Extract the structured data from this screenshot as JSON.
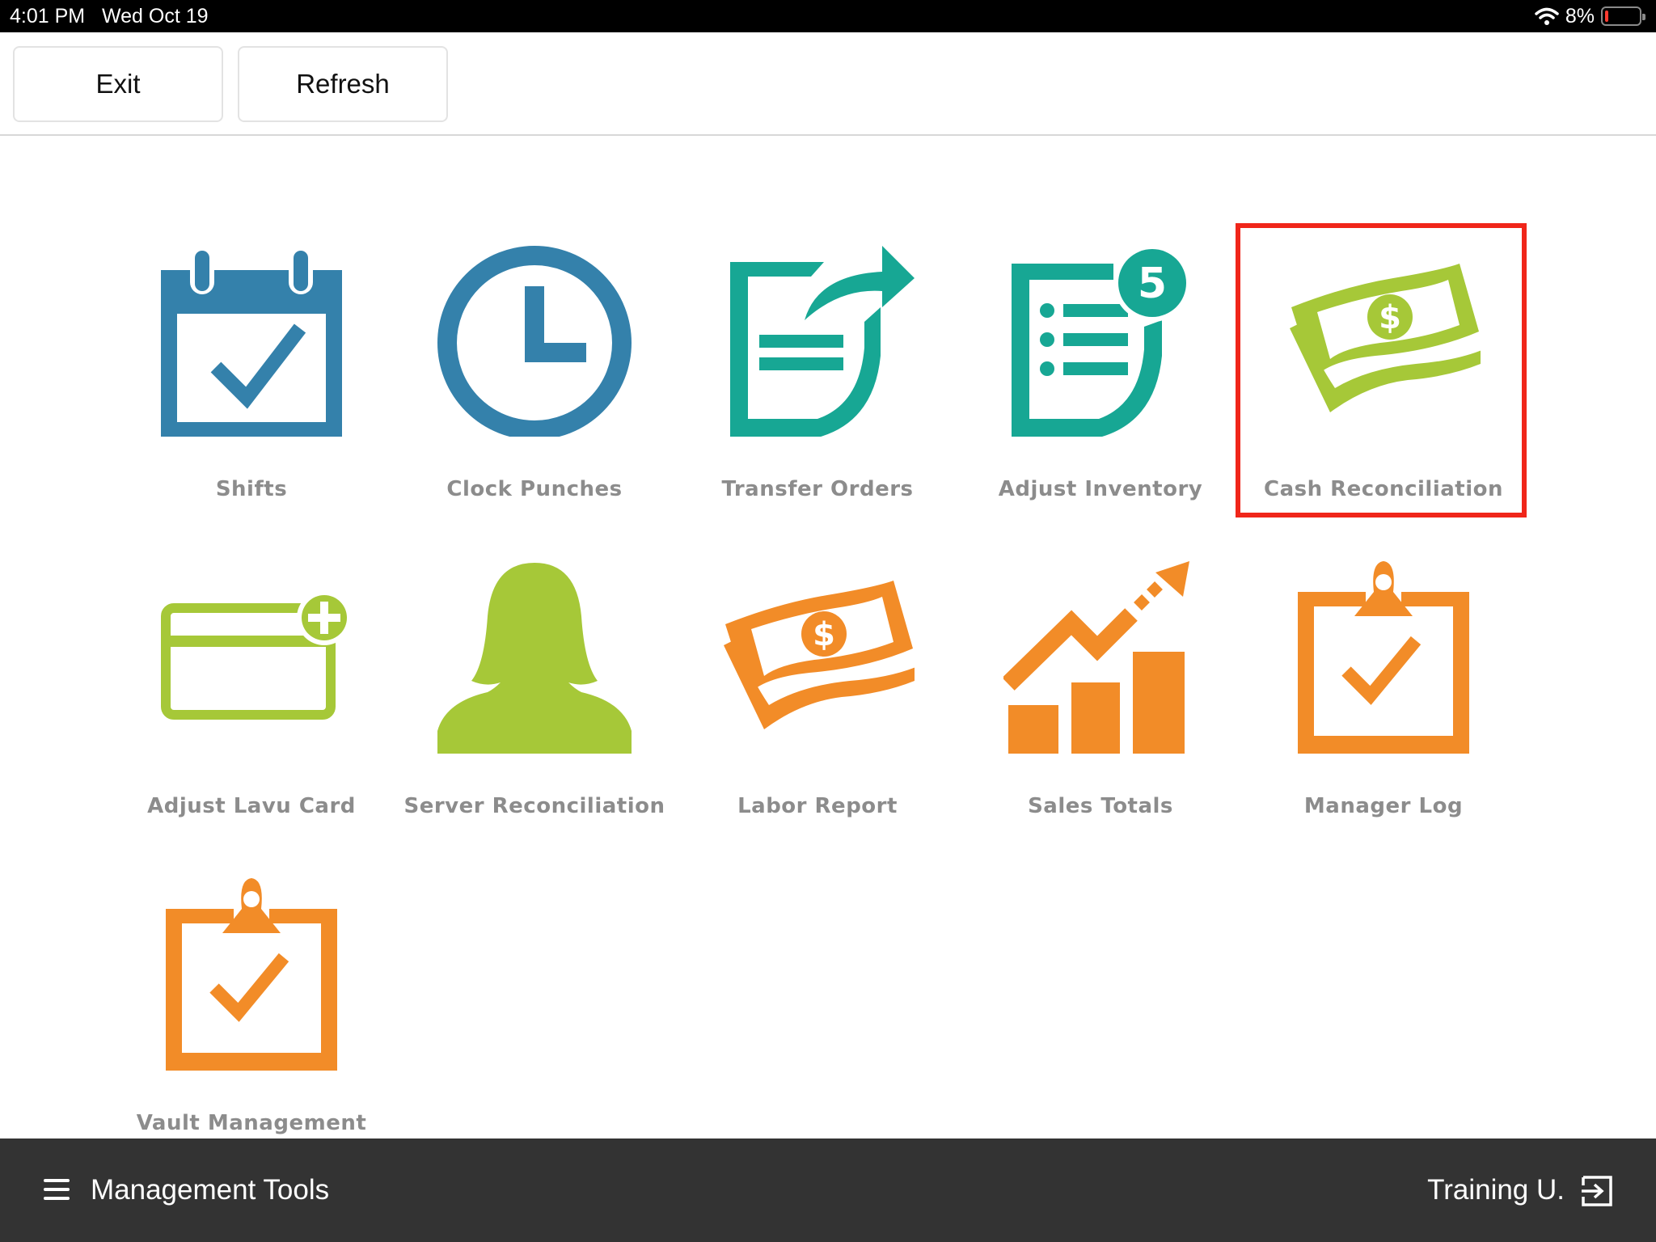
{
  "status_bar": {
    "time": "4:01 PM",
    "date": "Wed Oct 19",
    "battery": "8%",
    "wifi_icon": "wifi-icon",
    "battery_icon": "battery-icon"
  },
  "toolbar": {
    "exit_label": "Exit",
    "refresh_label": "Refresh"
  },
  "tools": [
    {
      "label": "Shifts",
      "icon": "calendar-check-icon",
      "color": "#3481ab"
    },
    {
      "label": "Clock Punches",
      "icon": "clock-icon",
      "color": "#3481ab"
    },
    {
      "label": "Transfer Orders",
      "icon": "document-transfer-icon",
      "color": "#17a794"
    },
    {
      "label": "Adjust Inventory",
      "icon": "inventory-list-icon",
      "color": "#17a794",
      "badge": "5"
    },
    {
      "label": "Cash Reconciliation",
      "icon": "cash-icon",
      "color": "#a6c838",
      "selected": true
    },
    {
      "label": "Adjust Lavu Card",
      "icon": "card-add-icon",
      "color": "#a6c838"
    },
    {
      "label": "Server Reconciliation",
      "icon": "person-icon",
      "color": "#a6c838"
    },
    {
      "label": "Labor Report",
      "icon": "cash-icon",
      "color": "#f28c28"
    },
    {
      "label": "Sales Totals",
      "icon": "growth-chart-icon",
      "color": "#f28c28"
    },
    {
      "label": "Manager Log",
      "icon": "clipboard-check-icon",
      "color": "#f28c28"
    },
    {
      "label": "Vault Management",
      "icon": "clipboard-check-icon",
      "color": "#f28c28"
    }
  ],
  "selection_color": "#f0261a",
  "bottom_bar": {
    "menu_icon": "hamburger-menu-icon",
    "title": "Management Tools",
    "user": "Training U.",
    "logout_icon": "logout-icon"
  }
}
